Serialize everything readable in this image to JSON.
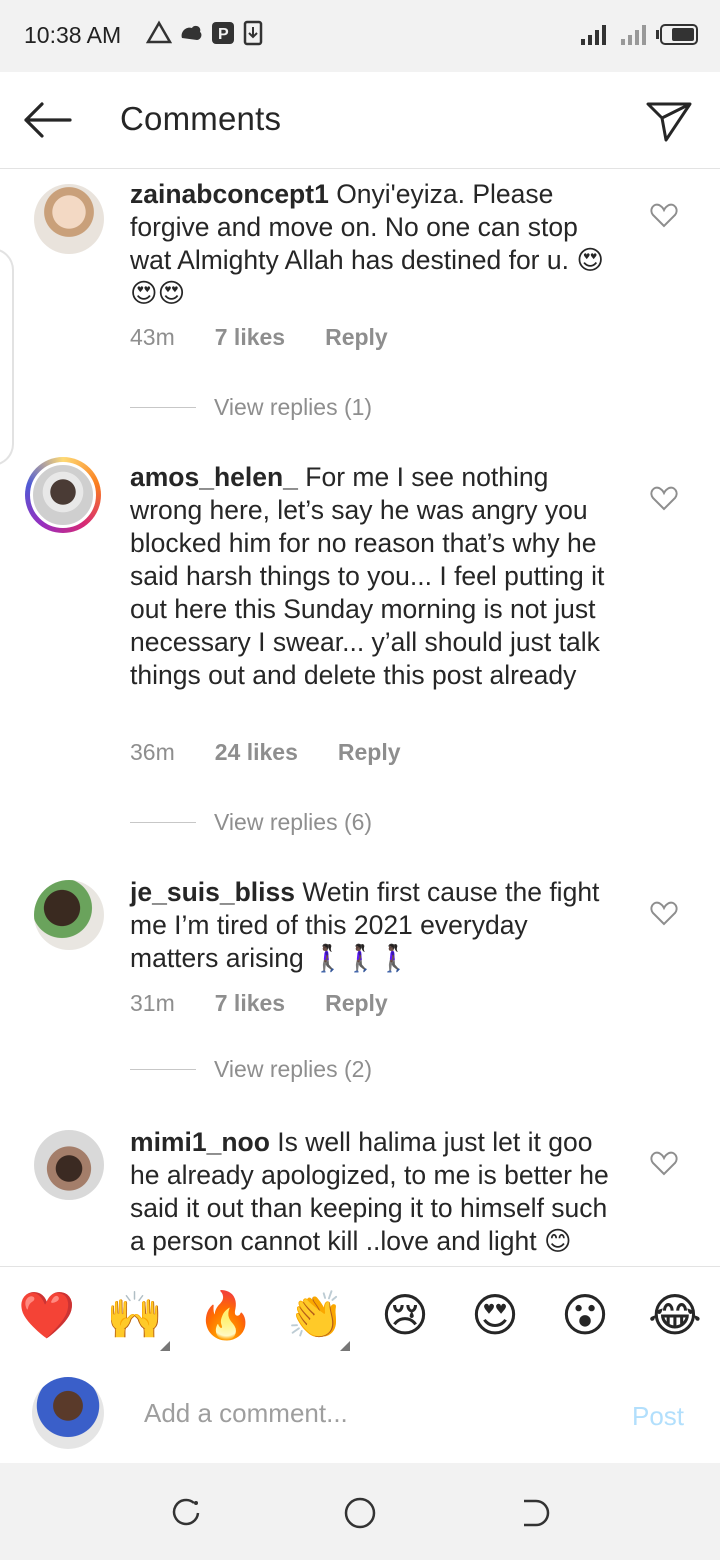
{
  "status_bar": {
    "time": "10:38 AM",
    "icons": [
      "warning-icon",
      "cloud-icon",
      "p-icon",
      "download-icon",
      "signal-icon",
      "signal-ht-icon",
      "battery-icon"
    ]
  },
  "header": {
    "title": "Comments",
    "back_icon": "arrow-left-icon",
    "send_icon": "paper-plane-icon"
  },
  "comments": [
    {
      "username": "zainabconcept1",
      "text": "Onyi'eyiza. Please forgive and move on. No one can stop wat Almighty Allah has destined for u. 😍😍😍",
      "time": "43m",
      "likes": "7 likes",
      "reply": "Reply",
      "view_replies": "View replies (1)"
    },
    {
      "username": "amos_helen_",
      "text": "For me I see nothing wrong here, let’s say he was angry you blocked him for no reason that’s why he said harsh things to you... I feel putting it out here this Sunday morning is not just necessary I swear... y’all should just talk things out and delete this post already",
      "time": "36m",
      "likes": "24 likes",
      "reply": "Reply",
      "view_replies": "View replies (6)"
    },
    {
      "username": "je_suis_bliss",
      "text": "Wetin first cause the fight me I’m tired of this 2021 everyday matters arising 🚶🏿‍♀️🚶🏿‍♀️🚶🏿‍♀️",
      "time": "31m",
      "likes": "7 likes",
      "reply": "Reply",
      "view_replies": "View replies (2)"
    },
    {
      "username": "mimi1_noo",
      "text": "Is well halima just let it goo he already apologized, to me is better he said it out than keeping it to himself such a person cannot kill ..love and light 😊"
    }
  ],
  "emoji_bar": [
    "❤️",
    "🙌",
    "🔥",
    "👏",
    "😢",
    "😍",
    "😮",
    "😂"
  ],
  "input": {
    "placeholder": "Add a comment...",
    "post_label": "Post"
  },
  "nav": [
    "recent-apps-icon",
    "home-icon",
    "back-icon"
  ]
}
